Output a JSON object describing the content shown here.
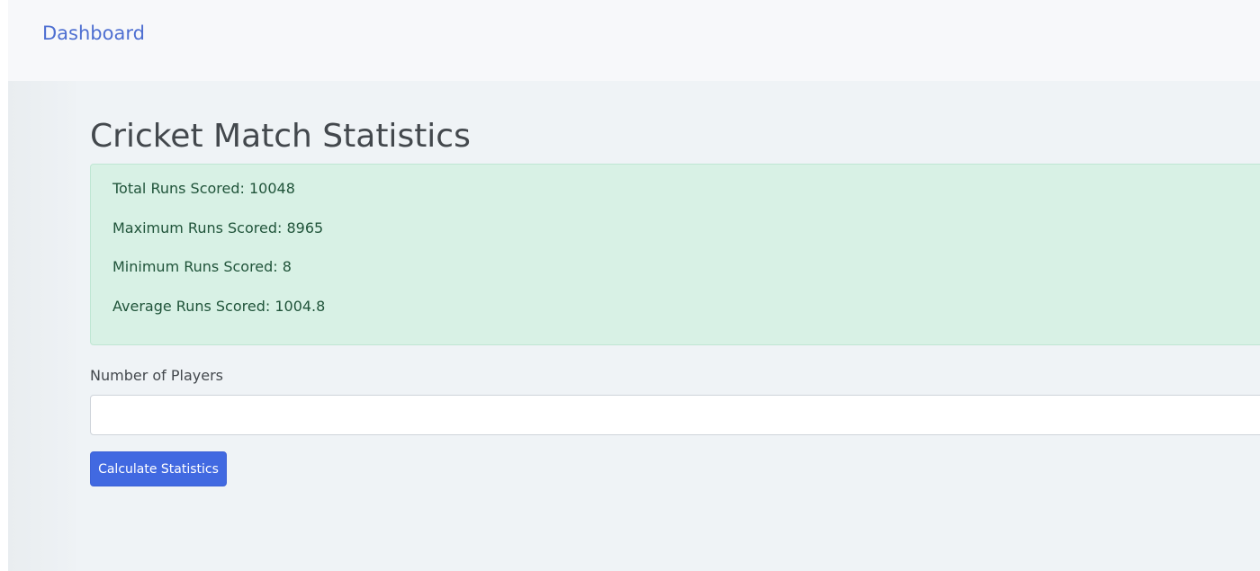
{
  "navbar": {
    "brand_label": "Dashboard"
  },
  "main": {
    "title": "Cricket Match Statistics",
    "stats": [
      "Total Runs Scored: 10048",
      "Maximum Runs Scored: 8965",
      "Minimum Runs Scored: 8",
      "Average Runs Scored: 1004.8"
    ],
    "form": {
      "players_label": "Number of Players",
      "players_value": "",
      "players_placeholder": "",
      "submit_label": "Calculate Statistics"
    }
  },
  "colors": {
    "brand": "#4e6fd1",
    "primary_button": "#4169e1",
    "success_alert_bg": "#d8f1e5",
    "success_alert_text": "#20543a",
    "page_bg": "#eff3f6"
  }
}
